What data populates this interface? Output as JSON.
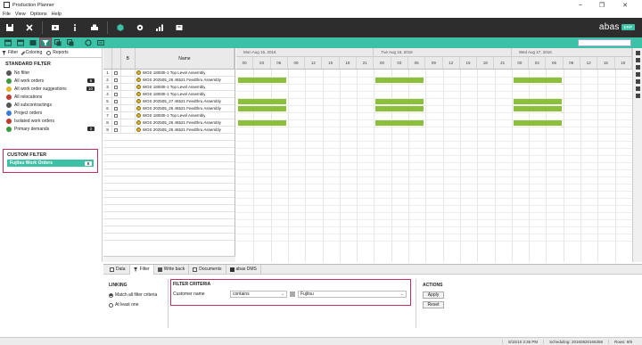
{
  "window": {
    "title": "Production Planner",
    "controls": [
      "–",
      "❐",
      "✕"
    ]
  },
  "menu": [
    "File",
    "View",
    "Options",
    "Help"
  ],
  "brand": {
    "logo": "abas",
    "badge": "ERP"
  },
  "left": {
    "tabs": [
      "Filter",
      "Coloring",
      "Reports"
    ],
    "standard_heading": "STANDARD FILTER",
    "standard_items": [
      {
        "label": "No filter",
        "color": "#555555",
        "count": ""
      },
      {
        "label": "All work orders",
        "color": "#3b9a3b",
        "count": "6"
      },
      {
        "label": "All work order suggestions",
        "color": "#e3b32a",
        "count": "10"
      },
      {
        "label": "All relocations",
        "color": "#c0392b",
        "count": ""
      },
      {
        "label": "All subcontractings",
        "color": "#555555",
        "count": ""
      },
      {
        "label": "Project orders",
        "color": "#3a7bd5",
        "count": ""
      },
      {
        "label": "Isolated work orders",
        "color": "#c0392b",
        "count": ""
      },
      {
        "label": "Primary demands",
        "color": "#3b9a3b",
        "count": "2"
      }
    ],
    "custom_heading": "CUSTOM FILTER",
    "custom_items": [
      {
        "label": "Fujitsu Work Orders",
        "count": "5"
      }
    ]
  },
  "grid": {
    "headers": {
      "flag": "B",
      "name": "Name"
    },
    "rows": [
      {
        "num": "1",
        "name": "WOS 18000I-1 Top Level Assembly"
      },
      {
        "num": "2",
        "name": "WOS 202505_26 46521 Feedthru Assembly"
      },
      {
        "num": "3",
        "name": "WOS 18000I-1 Top Level Assembly"
      },
      {
        "num": "4",
        "name": "WOS 18000I-1 Top Level Assembly"
      },
      {
        "num": "5",
        "name": "WOS 202505_27 46521 Feedthru Assembly"
      },
      {
        "num": "6",
        "name": "WOS 202505_26 46521 Feedthru Assembly"
      },
      {
        "num": "7",
        "name": "WOS 18000I-1 Top Level Assembly"
      },
      {
        "num": "8",
        "name": "WOS 202505_26 46521 Feedthru Assembly"
      },
      {
        "num": "9",
        "name": "WOS 202505_25 46521 Feedthru Assembly"
      }
    ]
  },
  "gantt": {
    "days": [
      "Mon Aug 15, 2016",
      "Tue Aug 16, 2016",
      "Wed Aug 17, 2016"
    ],
    "hours": [
      "00",
      "03",
      "06",
      "09",
      "12",
      "15",
      "18",
      "21",
      "00",
      "03",
      "06",
      "09",
      "12",
      "15",
      "18",
      "21",
      "00",
      "03",
      "06",
      "09",
      "12",
      "15",
      "18"
    ],
    "bar_rows": [
      2,
      5,
      6,
      8
    ]
  },
  "bottom": {
    "tabs": [
      "Data",
      "Filter",
      "Write back",
      "Documents",
      "abas DMS"
    ],
    "linking": {
      "title": "LINKING",
      "options": [
        "Match all filter criteria",
        "At least one"
      ]
    },
    "criteria": {
      "title": "FILTER CRITERIA",
      "field_label": "Customer name",
      "operator": "contains",
      "value": "Fujitsu"
    },
    "actions": {
      "title": "ACTIONS",
      "apply": "Apply",
      "reset": "Reset"
    }
  },
  "status": [
    "8/15/16 3:36 PM",
    "Scheduling: 20160820165358",
    "Rows: 9/9"
  ]
}
